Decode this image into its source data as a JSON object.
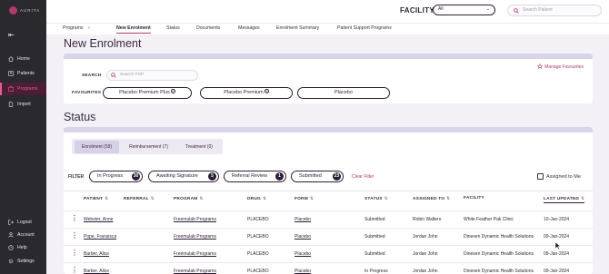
{
  "brand": {
    "name": "AURITA"
  },
  "sidebar": {
    "items": [
      {
        "label": "Home",
        "icon": "home-icon"
      },
      {
        "label": "Patients",
        "icon": "patients-icon"
      },
      {
        "label": "Programs",
        "icon": "programs-icon",
        "active": true
      },
      {
        "label": "Import",
        "icon": "import-icon"
      }
    ],
    "bottom_items": [
      {
        "label": "Logout",
        "icon": "logout-icon"
      },
      {
        "label": "Account",
        "icon": "account-icon"
      },
      {
        "label": "Help",
        "icon": "help-icon"
      },
      {
        "label": "Settings",
        "icon": "settings-icon"
      }
    ]
  },
  "header": {
    "facility_label": "FACILITY",
    "facility_value": "All",
    "search_placeholder": "Search Patient"
  },
  "tabs": {
    "breadcrumb_root": "Programs",
    "items": [
      "New Enrolment",
      "Status",
      "Documents",
      "Messages",
      "Enrolment Summary",
      "Patient Support Programs"
    ],
    "active": "New Enrolment"
  },
  "new_enrolment": {
    "title": "New Enrolment",
    "manage_favourites": "Manage Favourites",
    "search_label": "SEARCH",
    "search_placeholder": "Search PSP",
    "favourites_label": "FAVOURITES",
    "favourites": [
      "Placebo Premium Plus",
      "Placebo Premium",
      "Placebo"
    ]
  },
  "status": {
    "title": "Status",
    "segments": [
      "Enrolment (59)",
      "Reimbursement (7)",
      "Treatment (0)"
    ],
    "active_segment": "Enrolment (59)",
    "filter_label": "FILTER",
    "filters": [
      {
        "label": "In Progress",
        "count": "30"
      },
      {
        "label": "Awaiting Signature",
        "count": "5"
      },
      {
        "label": "Referral Review",
        "count": "1"
      },
      {
        "label": "Submitted",
        "count": "23"
      }
    ],
    "clear_filter": "Clear Filter",
    "assigned_to_me": "Assigned to Me",
    "columns": [
      "PATIENT",
      "REFERRAL",
      "PROGRAM",
      "DRUG",
      "FORM",
      "STATUS",
      "ASSIGNED TO",
      "FACILITY",
      "LAST UPDATED"
    ],
    "rows": [
      {
        "patient": "Webster, Anne",
        "referral": "",
        "program": "Freemulab Programs",
        "drug": "PLACEBO",
        "form": "Placebo",
        "status": "Submitted",
        "assigned": "Robin Walters",
        "facility": "White Feather Pak Clinic",
        "updated": "10-Jan-2024"
      },
      {
        "patient": "Pope, Fransisca",
        "referral": "",
        "program": "Freemulab Programs",
        "drug": "PLACEBO",
        "form": "Placebo",
        "status": "Submitted",
        "assigned": "Jordan John",
        "facility": "Dinesen Dynamic Health Solutions",
        "updated": "09-Jan-2024"
      },
      {
        "patient": "Barber, Alice",
        "referral": "",
        "program": "Freemulab Programs",
        "drug": "PLACEBO",
        "form": "Placebo",
        "status": "Submitted",
        "assigned": "Jordan John",
        "facility": "Dinesen Dynamic Health Solutions",
        "updated": "09-Jan-2024"
      },
      {
        "patient": "Barber, Alice",
        "referral": "",
        "program": "Freemulab Programs",
        "drug": "PLACEBO",
        "form": "Placebo",
        "status": "In Progress",
        "assigned": "Jordan John",
        "facility": "Dinesen Dynamic Health Solutions",
        "updated": "09-Jan-2024"
      }
    ]
  },
  "colors": {
    "accent": "#b13a6c",
    "sidebar_bg": "#2a2a2e",
    "band": "#d9d4e8"
  }
}
